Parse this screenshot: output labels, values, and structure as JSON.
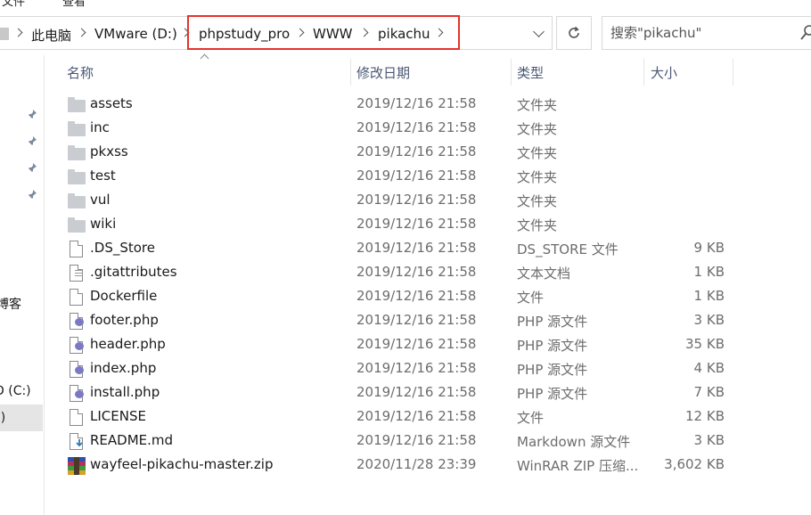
{
  "ribbon": {
    "partial_items": [
      "文件",
      "查看"
    ]
  },
  "address_bar": {
    "crumbs": [
      "此电脑",
      "VMware (D:)",
      "phpstudy_pro",
      "WWW",
      "pikachu"
    ]
  },
  "search": {
    "placeholder": "搜索\"pikachu\""
  },
  "nav_pane": {
    "partial_labels": [
      "博客",
      "D (C:)",
      ":)"
    ]
  },
  "columns": {
    "name": "名称",
    "date": "修改日期",
    "type": "类型",
    "size": "大小"
  },
  "files": [
    {
      "name": "assets",
      "date": "2019/12/16 21:58",
      "type": "文件夹",
      "size": "",
      "icon": "folder-icon"
    },
    {
      "name": "inc",
      "date": "2019/12/16 21:58",
      "type": "文件夹",
      "size": "",
      "icon": "folder-icon"
    },
    {
      "name": "pkxss",
      "date": "2019/12/16 21:58",
      "type": "文件夹",
      "size": "",
      "icon": "folder-icon"
    },
    {
      "name": "test",
      "date": "2019/12/16 21:58",
      "type": "文件夹",
      "size": "",
      "icon": "folder-icon"
    },
    {
      "name": "vul",
      "date": "2019/12/16 21:58",
      "type": "文件夹",
      "size": "",
      "icon": "folder-icon"
    },
    {
      "name": "wiki",
      "date": "2019/12/16 21:58",
      "type": "文件夹",
      "size": "",
      "icon": "folder-icon"
    },
    {
      "name": ".DS_Store",
      "date": "2019/12/16 21:58",
      "type": "DS_STORE 文件",
      "size": "9 KB",
      "icon": "file-icon"
    },
    {
      "name": ".gitattributes",
      "date": "2019/12/16 21:58",
      "type": "文本文档",
      "size": "1 KB",
      "icon": "text-file-icon"
    },
    {
      "name": "Dockerfile",
      "date": "2019/12/16 21:58",
      "type": "文件",
      "size": "1 KB",
      "icon": "file-icon"
    },
    {
      "name": "footer.php",
      "date": "2019/12/16 21:58",
      "type": "PHP 源文件",
      "size": "3 KB",
      "icon": "php-file-icon"
    },
    {
      "name": "header.php",
      "date": "2019/12/16 21:58",
      "type": "PHP 源文件",
      "size": "35 KB",
      "icon": "php-file-icon"
    },
    {
      "name": "index.php",
      "date": "2019/12/16 21:58",
      "type": "PHP 源文件",
      "size": "4 KB",
      "icon": "php-file-icon"
    },
    {
      "name": "install.php",
      "date": "2019/12/16 21:58",
      "type": "PHP 源文件",
      "size": "7 KB",
      "icon": "php-file-icon"
    },
    {
      "name": "LICENSE",
      "date": "2019/12/16 21:58",
      "type": "文件",
      "size": "12 KB",
      "icon": "file-icon"
    },
    {
      "name": "README.md",
      "date": "2019/12/16 21:58",
      "type": "Markdown 源文件",
      "size": "3 KB",
      "icon": "markdown-file-icon"
    },
    {
      "name": "wayfeel-pikachu-master.zip",
      "date": "2020/11/28 23:39",
      "type": "WinRAR ZIP 压缩...",
      "size": "3,602 KB",
      "icon": "winrar-zip-icon"
    }
  ],
  "colors": {
    "highlight_border": "#e5322d",
    "header_text": "#4b5875",
    "detail_text": "#6d6d6d"
  }
}
